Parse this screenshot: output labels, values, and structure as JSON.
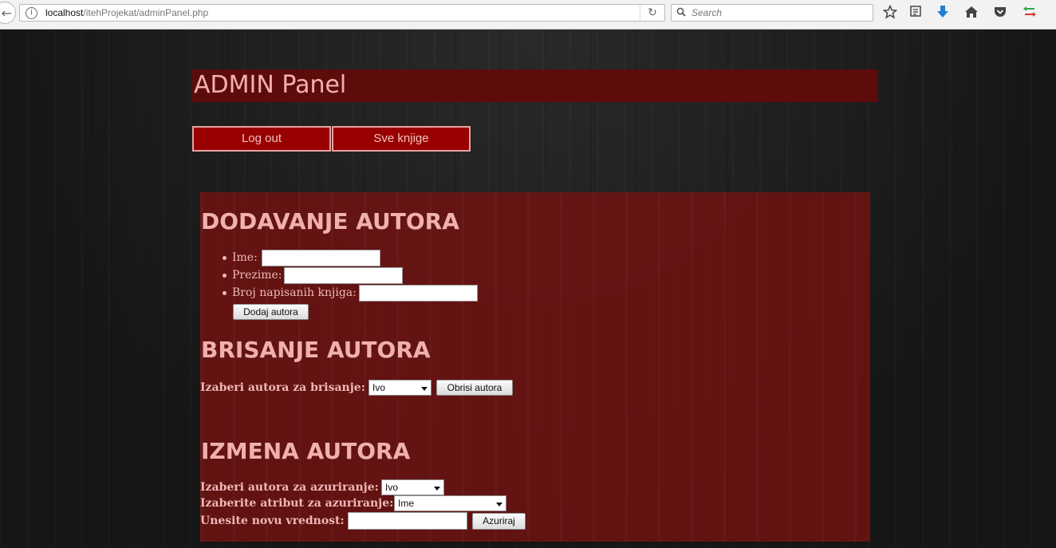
{
  "browser": {
    "url_host": "localhost",
    "url_path": "/itehProjekat/adminPanel.php",
    "search_placeholder": "Search",
    "icons": [
      "back-icon",
      "info-icon",
      "reload-icon",
      "search-icon",
      "bookmark-star-icon",
      "reading-list-icon",
      "download-icon",
      "home-icon",
      "pocket-icon",
      "sync-icon"
    ]
  },
  "header": {
    "title": "ADMIN Panel"
  },
  "nav": {
    "logout_label": "Log out",
    "books_label": "Sve knjige"
  },
  "add_author": {
    "title": "DODAVANJE AUTORA",
    "first_name_label": "Ime:",
    "last_name_label": "Prezime:",
    "books_count_label": "Broj napisanih knjiga:",
    "first_name_value": "",
    "last_name_value": "",
    "books_count_value": "",
    "submit_label": "Dodaj autora"
  },
  "delete_author": {
    "title": "BRISANJE AUTORA",
    "select_label": "Izaberi autora za brisanje:",
    "selected_author": "Ivo",
    "submit_label": "Obrisi autora"
  },
  "update_author": {
    "title": "IZMENA AUTORA",
    "author_label": "Izaberi autora za azuriranje:",
    "selected_author": "Ivo",
    "attribute_label": "Izaberite atribut za azuriranje:",
    "selected_attribute": "Ime",
    "new_value_label": "Unesite novu vrednost:",
    "new_value": "",
    "submit_label": "Azuriraj"
  },
  "colors": {
    "header_bg": "#5e0b0b",
    "nav_button_bg": "#990000",
    "panel_bg": "#6e1212",
    "text_pink": "#f0b0b0"
  }
}
